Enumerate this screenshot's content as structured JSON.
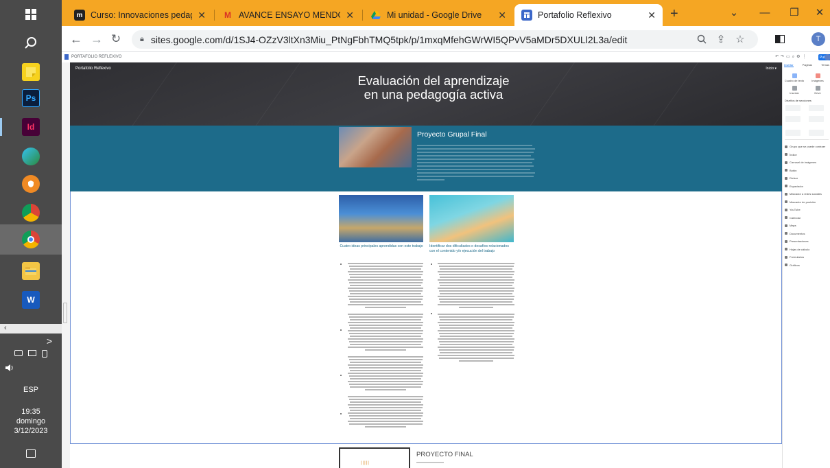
{
  "taskbar": {
    "tray_arrow": ">",
    "keyboard_indicator": "ESP",
    "clock_time": "19:35",
    "clock_day": "domingo",
    "clock_date": "3/12/2023"
  },
  "tabs": [
    {
      "favicon": "m",
      "title": "Curso: Innovaciones pedagógica"
    },
    {
      "favicon": "M",
      "title": "AVANCE ENSAYO MENDOZA AR"
    },
    {
      "favicon": "drive",
      "title": "Mi unidad - Google Drive"
    },
    {
      "favicon": "sites",
      "title": "Portafolio Reflexivo"
    }
  ],
  "new_tab_label": "+",
  "address_bar": {
    "url": "sites.google.com/d/1SJ4-OZzV3ltXn3Miu_PtNgFbhTMQ5tpk/p/1mxqMfehGWrWI5QPvV5aMDr5DXULl2L3a/edit"
  },
  "sites_editor": {
    "document_name": "PORTAFOLIO REFLEXIVO",
    "publish_label": "Publicar",
    "site_name": "Portafolio Reflexivo",
    "header_menu": "Inicio ▾",
    "header_title": "Evaluación del aprendizaje en una pedagogía activa",
    "project_title": "Proyecto Grupal Final",
    "col_left_heading": "Cuatro ideas principales aprendidas con este trabajo",
    "col_right_heading": "Identificar dos dificultades o desafíos relacionados con el contenido y/o ejecución del trabajo",
    "bottom_title": "PROYECTO FINAL"
  },
  "insert_panel": {
    "tabs": [
      "Insertar",
      "Páginas",
      "Temas"
    ],
    "grid": [
      "Cuadro de texto",
      "Imágenes",
      "Insertar",
      "Drive"
    ],
    "section_title": "Diseños de secciones",
    "list": [
      "Grupo que se puede contraer",
      "Índice",
      "Carrusel de imágenes",
      "Botón",
      "Divisor",
      "Espaciador",
      "Marcador a redes sociales",
      "Marcador de posición",
      "YouTube",
      "Calendar",
      "Maps",
      "Documentos",
      "Presentaciones",
      "Hojas de cálculo",
      "Formularios",
      "Gráficos"
    ]
  },
  "colors": {
    "tabstrip": "#f5a623",
    "taskbar": "#4a4a4a",
    "project_band": "#1d6b8a",
    "header": "#333337",
    "accent": "#1a73e8"
  }
}
